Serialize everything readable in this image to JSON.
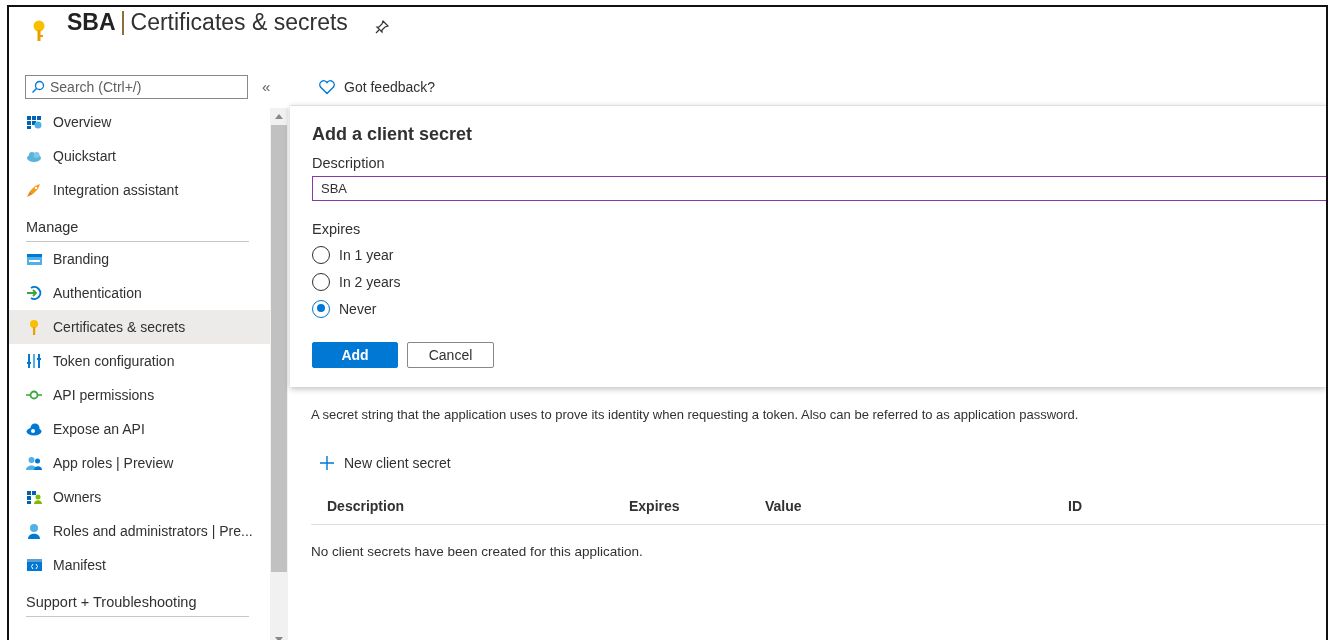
{
  "header": {
    "title_bold": "SBA",
    "title_rest": "Certificates & secrets"
  },
  "sidebar": {
    "search": {
      "placeholder": "Search (Ctrl+/)"
    },
    "collapse": "«",
    "items": [
      {
        "kind": "item",
        "label": "Overview",
        "selected": false
      },
      {
        "kind": "item",
        "label": "Quickstart",
        "selected": false
      },
      {
        "kind": "item",
        "label": "Integration assistant",
        "selected": false
      },
      {
        "kind": "section",
        "label": "Manage"
      },
      {
        "kind": "item",
        "label": "Branding",
        "selected": false
      },
      {
        "kind": "item",
        "label": "Authentication",
        "selected": false
      },
      {
        "kind": "item",
        "label": "Certificates & secrets",
        "selected": true
      },
      {
        "kind": "item",
        "label": "Token configuration",
        "selected": false
      },
      {
        "kind": "item",
        "label": "API permissions",
        "selected": false
      },
      {
        "kind": "item",
        "label": "Expose an API",
        "selected": false
      },
      {
        "kind": "item",
        "label": "App roles | Preview",
        "selected": false
      },
      {
        "kind": "item",
        "label": "Owners",
        "selected": false
      },
      {
        "kind": "item",
        "label": "Roles and administrators | Pre...",
        "selected": false
      },
      {
        "kind": "item",
        "label": "Manifest",
        "selected": false
      },
      {
        "kind": "section",
        "label": "Support + Troubleshooting"
      }
    ]
  },
  "feedback": "Got feedback?",
  "dialog": {
    "title": "Add a client secret",
    "description_label": "Description",
    "description_value": "SBA",
    "expires_label": "Expires",
    "options": [
      {
        "label": "In 1 year",
        "selected": false
      },
      {
        "label": "In 2 years",
        "selected": false
      },
      {
        "label": "Never",
        "selected": true
      }
    ],
    "buttons": [
      {
        "kind": "primary",
        "label": "Add"
      },
      {
        "kind": "secondary",
        "label": "Cancel"
      }
    ]
  },
  "info": "A secret string that the application uses to prove its identity when requesting a token. Also can be referred to as application password.",
  "new_secret": "New client secret",
  "table": {
    "columns": [
      "Description",
      "Expires",
      "Value",
      "ID"
    ],
    "empty": "No client secrets have been created for this application."
  }
}
